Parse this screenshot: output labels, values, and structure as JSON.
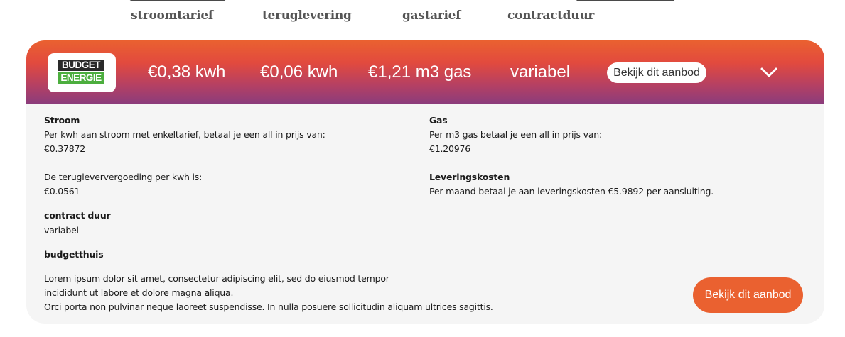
{
  "columns": {
    "stroomtarief": "stroomtarief",
    "teruglevering": "teruglevering",
    "gastarief": "gastarief",
    "contractduur": "contractduur"
  },
  "offer": {
    "logo": {
      "line1": "BUDGET",
      "line2": "ENERGIE",
      "colors": {
        "top": "#2a2a2a",
        "bottom": "#4cae3e"
      }
    },
    "stroom_price": "€0,38 kwh",
    "teruglevering_price": "€0,06 kwh",
    "gas_price": "€1,21 m3 gas",
    "contract": "variabel",
    "header_button": "Bekijk dit aanbod",
    "toggle_icon": "chevron-down-icon",
    "colors": {
      "accent": "#ea6130",
      "gradient_end": "#8a3c7c",
      "panel_bg": "#f5f5f5"
    }
  },
  "details": {
    "stroom": {
      "title": "Stroom",
      "text": "Per kwh aan stroom met enkeltarief, betaal je een all in prijs van:",
      "value": "€0.37872"
    },
    "teruglevering": {
      "text": "De terugleververgoeding per kwh is:",
      "value": "€0.0561"
    },
    "gas": {
      "title": "Gas",
      "text": "Per m3 gas betaal je een all in prijs van:",
      "value": "€1.20976"
    },
    "leveringskosten": {
      "title": "Leveringskosten",
      "text": "Per maand betaal je aan leveringskosten €5.9892 per aansluiting."
    },
    "contract": {
      "title": "contract duur",
      "value": "variabel"
    },
    "budgetthuis": {
      "title": "budgetthuis",
      "lines": [
        "Lorem ipsum dolor sit amet, consectetur adipiscing elit, sed do eiusmod tempor",
        "incididunt ut labore et dolore magna aliqua.",
        "Orci porta non pulvinar neque laoreet suspendisse. In nulla posuere sollicitudin aliquam ultrices sagittis."
      ]
    },
    "footer_button": "Bekijk dit aanbod"
  }
}
